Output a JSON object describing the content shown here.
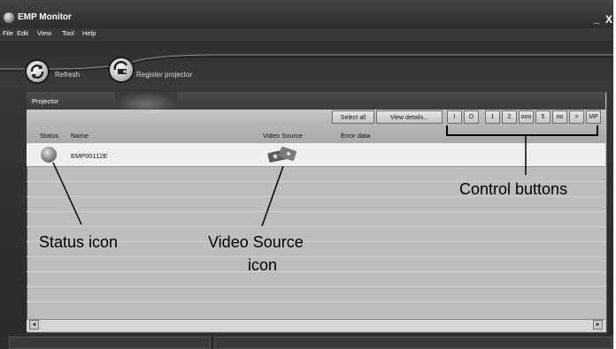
{
  "window": {
    "title": "EMP Monitor",
    "minimize_label": "_",
    "close_label": "X"
  },
  "menu": [
    "File",
    "Edit",
    "View",
    "Tool",
    "Help"
  ],
  "toolbar": {
    "refresh_label": "Refresh",
    "register_label": "Register projector"
  },
  "panel": {
    "title": "Projector",
    "buttons": {
      "select_all": "Select all",
      "view_details": "View details..."
    },
    "control_buttons": [
      "I",
      "O",
      "1",
      "2",
      "ooo",
      "5",
      "oo",
      "=",
      "MP"
    ],
    "columns": {
      "status": "Status",
      "name": "Name",
      "video_source": "Video Source",
      "error_data": "Error data"
    },
    "rows": [
      {
        "name": "EMP00112E",
        "error_data": ""
      }
    ]
  },
  "scrollbar": {
    "left_arrow": "◂",
    "right_arrow": "▸"
  },
  "annotations": {
    "control_buttons": "Control buttons",
    "status_icon": "Status icon",
    "video_source_line1": "Video Source",
    "video_source_line2": "icon"
  }
}
